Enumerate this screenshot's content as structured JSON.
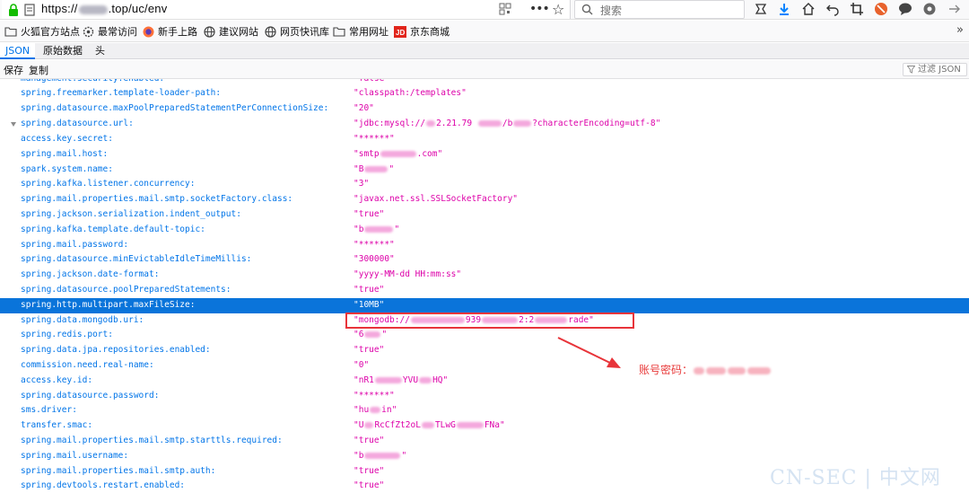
{
  "browser": {
    "url_prefix": "https://",
    "url_suffix": ".top/uc/env",
    "search_placeholder": "搜索"
  },
  "bookmarks": [
    {
      "label": "火狐官方站点",
      "icon": "folder-icon"
    },
    {
      "label": "最常访问",
      "icon": "gear-icon"
    },
    {
      "label": "新手上路",
      "icon": "firefox-icon"
    },
    {
      "label": "建议网站",
      "icon": "globe-icon"
    },
    {
      "label": "网页快讯库",
      "icon": "globe-icon"
    },
    {
      "label": "常用网址",
      "icon": "folder-icon"
    },
    {
      "label": "京东商城",
      "icon": "jd-icon"
    }
  ],
  "tabs": [
    "JSON",
    "原始数据",
    "头"
  ],
  "actions": {
    "save": "保存",
    "copy": "复制",
    "filter": "过滤 JSON"
  },
  "rows": [
    {
      "key": "management.security.enabled:",
      "val": "\"false\""
    },
    {
      "key": "spring.freemarker.template-loader-path:",
      "val": "\"classpath:/templates\""
    },
    {
      "key": "spring.datasource.maxPoolPreparedStatementPerConnectionSize:",
      "val": "\"20\""
    },
    {
      "key": "spring.datasource.url:",
      "val": "\"jdbc:mysql://",
      "val_tail": "2.21.79 ",
      "val_tail2": "/b",
      "val_tail3": "?characterEncoding=utf-8\"",
      "twisty": true
    },
    {
      "key": "access.key.secret:",
      "val": "\"******\""
    },
    {
      "key": "spring.mail.host:",
      "val": "\"smtp",
      "val_tail": ".com\""
    },
    {
      "key": "spark.system.name:",
      "val": "\"B",
      "val_tail": "\""
    },
    {
      "key": "spring.kafka.listener.concurrency:",
      "val": "\"3\""
    },
    {
      "key": "spring.mail.properties.mail.smtp.socketFactory.class:",
      "val": "\"javax.net.ssl.SSLSocketFactory\""
    },
    {
      "key": "spring.jackson.serialization.indent_output:",
      "val": "\"true\""
    },
    {
      "key": "spring.kafka.template.default-topic:",
      "val": "\"b",
      "val_tail": "\""
    },
    {
      "key": "spring.mail.password:",
      "val": "\"******\""
    },
    {
      "key": "spring.datasource.minEvictableIdleTimeMillis:",
      "val": "\"300000\""
    },
    {
      "key": "spring.jackson.date-format:",
      "val": "\"yyyy-MM-dd HH:mm:ss\""
    },
    {
      "key": "spring.datasource.poolPreparedStatements:",
      "val": "\"true\""
    },
    {
      "key": "spring.http.multipart.maxFileSize:",
      "val": "\"10MB\"",
      "selected": true
    },
    {
      "key": "spring.data.mongodb.uri:",
      "val": "\"mongodb://",
      "val_tail": "939",
      "val_tail2": "2:2",
      "val_tail3": "rade\""
    },
    {
      "key": "spring.redis.port:",
      "val": "\"6",
      "val_tail": "\""
    },
    {
      "key": "spring.data.jpa.repositories.enabled:",
      "val": "\"true\""
    },
    {
      "key": "commission.need.real-name:",
      "val": "\"0\""
    },
    {
      "key": "access.key.id:",
      "val": "\"nR1",
      "val_tail": "YVU",
      "val_tail2": "HQ\""
    },
    {
      "key": "spring.datasource.password:",
      "val": "\"******\""
    },
    {
      "key": "sms.driver:",
      "val": "\"hu",
      "val_tail": "in\""
    },
    {
      "key": "transfer.smac:",
      "val": "\"U",
      "val_tail": "RcCfZt2oL",
      "val_tail2": "TLwG",
      "val_tail3": "FNa\""
    },
    {
      "key": "spring.mail.properties.mail.smtp.starttls.required:",
      "val": "\"true\""
    },
    {
      "key": "spring.mail.username:",
      "val": "\"b",
      "val_tail": "\""
    },
    {
      "key": "spring.mail.properties.mail.smtp.auth:",
      "val": "\"true\""
    },
    {
      "key": "spring.devtools.restart.enabled:",
      "val": "\"true\""
    }
  ],
  "annotation": {
    "label": "账号密码：",
    "color": "#e83a3a"
  },
  "watermark": "CN-SEC | 中文网",
  "colors": {
    "key": "#0074e8",
    "value": "#dd00a9",
    "selection": "#0a74da",
    "highlight": "#e8343a"
  }
}
